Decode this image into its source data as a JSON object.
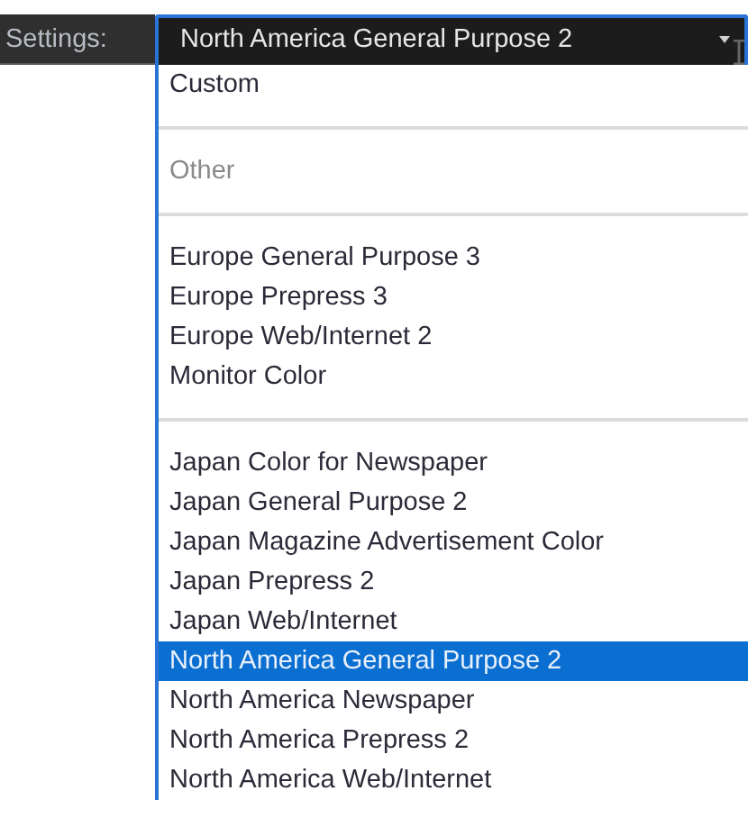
{
  "settings_label": "Settings:",
  "dropdown": {
    "value": "North America General Purpose 2",
    "expanded": true
  },
  "options": [
    {
      "kind": "item",
      "label": "Custom",
      "disabled": false,
      "selected": false
    },
    {
      "kind": "separator"
    },
    {
      "kind": "item",
      "label": "Other",
      "disabled": true,
      "selected": false
    },
    {
      "kind": "separator"
    },
    {
      "kind": "item",
      "label": "Europe General Purpose 3",
      "disabled": false,
      "selected": false
    },
    {
      "kind": "item",
      "label": "Europe Prepress 3",
      "disabled": false,
      "selected": false
    },
    {
      "kind": "item",
      "label": "Europe Web/Internet 2",
      "disabled": false,
      "selected": false
    },
    {
      "kind": "item",
      "label": "Monitor Color",
      "disabled": false,
      "selected": false
    },
    {
      "kind": "separator"
    },
    {
      "kind": "item",
      "label": "Japan Color for Newspaper",
      "disabled": false,
      "selected": false
    },
    {
      "kind": "item",
      "label": "Japan General Purpose 2",
      "disabled": false,
      "selected": false
    },
    {
      "kind": "item",
      "label": "Japan Magazine Advertisement Color",
      "disabled": false,
      "selected": false
    },
    {
      "kind": "item",
      "label": "Japan Prepress 2",
      "disabled": false,
      "selected": false
    },
    {
      "kind": "item",
      "label": "Japan Web/Internet",
      "disabled": false,
      "selected": false
    },
    {
      "kind": "item",
      "label": "North America General Purpose 2",
      "disabled": false,
      "selected": true
    },
    {
      "kind": "item",
      "label": "North America Newspaper",
      "disabled": false,
      "selected": false
    },
    {
      "kind": "item",
      "label": "North America Prepress 2",
      "disabled": false,
      "selected": false
    },
    {
      "kind": "item",
      "label": "North America Web/Internet",
      "disabled": false,
      "selected": false
    }
  ]
}
